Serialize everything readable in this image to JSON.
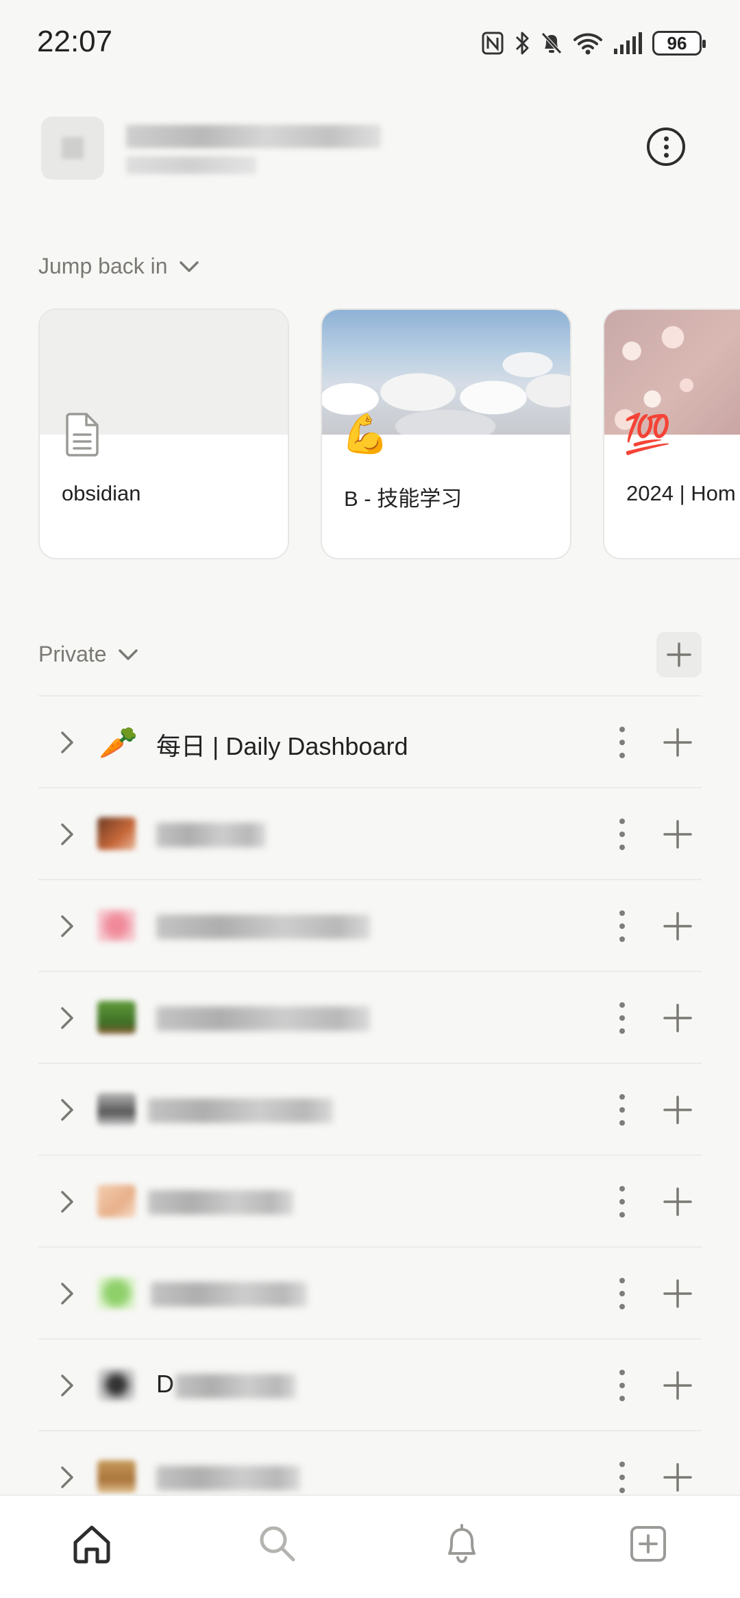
{
  "status_bar": {
    "time": "22:07",
    "battery": "96",
    "icons": [
      "nfc-icon",
      "bluetooth-icon",
      "mute-icon",
      "wifi-icon",
      "signal-icon",
      "battery-icon"
    ]
  },
  "workspace": {
    "avatar": "workspace-avatar",
    "more_icon": "more-circle-icon"
  },
  "jump_back_in": {
    "label": "Jump back in",
    "cards": [
      {
        "title": "obsidian",
        "icon": "page-icon",
        "cover": "none"
      },
      {
        "title": "B - 技能学习",
        "icon": "💪",
        "cover": "clouds"
      },
      {
        "title": "2024 | Hom",
        "icon": "💯",
        "cover": "bokeh"
      }
    ]
  },
  "private": {
    "label": "Private",
    "add_icon": "plus-icon",
    "pages": [
      {
        "title": "每日 | Daily Dashboard",
        "icon": "🥕",
        "blurred": false
      },
      {
        "title": "",
        "icon": "",
        "blurred": true
      },
      {
        "title": "",
        "icon": "",
        "blurred": true
      },
      {
        "title": "",
        "icon": "",
        "blurred": true
      },
      {
        "title": "",
        "icon": "",
        "blurred": true
      },
      {
        "title": "",
        "icon": "",
        "blurred": true
      },
      {
        "title": "",
        "icon": "",
        "blurred": true
      },
      {
        "title": "D",
        "icon": "",
        "blurred": true
      },
      {
        "title": "",
        "icon": "",
        "blurred": true
      }
    ]
  },
  "bottom_nav": {
    "items": [
      "home-icon",
      "search-icon",
      "bell-icon",
      "new-page-icon"
    ]
  }
}
